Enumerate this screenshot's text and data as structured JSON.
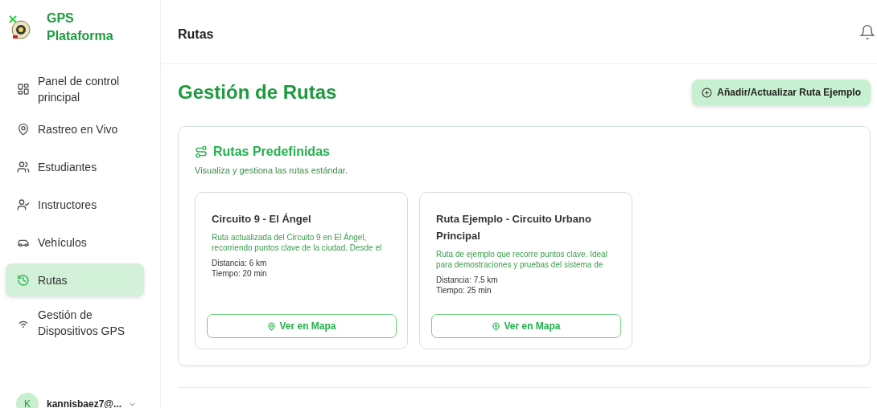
{
  "brand": {
    "name": "GPS Plataforma"
  },
  "sidebar": {
    "items": [
      {
        "label": "Panel de control principal",
        "selected": false
      },
      {
        "label": "Rastreo en Vivo",
        "selected": false
      },
      {
        "label": "Estudiantes",
        "selected": false
      },
      {
        "label": "Instructores",
        "selected": false
      },
      {
        "label": "Vehículos",
        "selected": false
      },
      {
        "label": "Rutas",
        "selected": true
      },
      {
        "label": "Gestión de Dispositivos GPS",
        "selected": false
      }
    ],
    "user": {
      "initial": "K",
      "email": "kannisbaez7@..."
    }
  },
  "header": {
    "title": "Rutas"
  },
  "page": {
    "title": "Gestión de Rutas",
    "action_button": "Añadir/Actualizar Ruta Ejemplo"
  },
  "panel": {
    "title": "Rutas Predefinidas",
    "subtitle": "Visualiza y gestiona las rutas estándar.",
    "routes": [
      {
        "name": "Circuito 9 - El Ángel",
        "description": "Ruta actualizada del Circuito 9 en El Ángel, recorriendo puntos clave de la ciudad. Desde el",
        "distance": "Distancia: 6 km",
        "time": "Tiempo: 20 min",
        "button": "Ver en Mapa"
      },
      {
        "name": "Ruta Ejemplo - Circuito Urbano Principal",
        "description": "Ruta de ejemplo que recorre puntos clave. Ideal para demostraciones y pruebas del sistema de",
        "distance": "Distancia: 7.5 km",
        "time": "Tiempo: 25 min",
        "button": "Ver en Mapa"
      }
    ]
  }
}
